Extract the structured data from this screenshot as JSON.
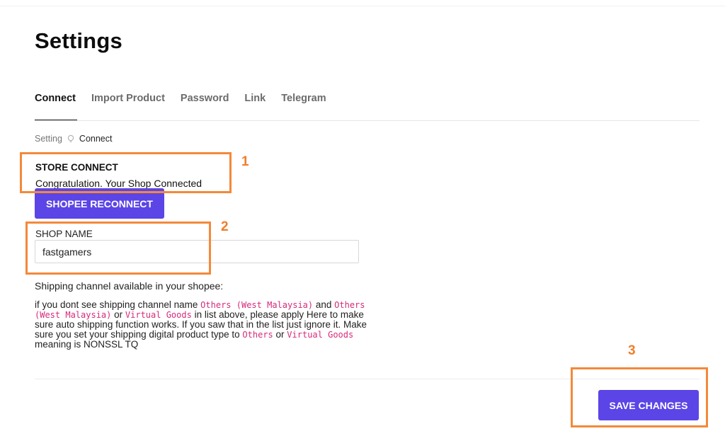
{
  "page": {
    "title": "Settings"
  },
  "tabs": [
    {
      "label": "Connect",
      "active": true
    },
    {
      "label": "Import Product"
    },
    {
      "label": "Password"
    },
    {
      "label": "Link"
    },
    {
      "label": "Telegram"
    }
  ],
  "breadcrumb": {
    "root": "Setting",
    "current": "Connect",
    "separator_icon": "bulb-icon"
  },
  "store": {
    "title": "STORE CONNECT",
    "status": "Congratulation. Your Shop Connected",
    "reconnect_label": "SHOPEE RECONNECT"
  },
  "shop": {
    "label": "SHOP NAME",
    "value": "fastgamers"
  },
  "shipping": {
    "label": "Shipping channel available in your shopee:",
    "note": {
      "t1": "if you dont see shipping channel name ",
      "c1": "Others (West Malaysia)",
      "t2": " and ",
      "c2": "Others (West Malaysia)",
      "t3": " or ",
      "c3": "Virtual Goods",
      "t4": " in list above, please apply Here to make sure auto shipping function works. If you saw that in the list just ignore it. Make sure you set your shipping digital product type to ",
      "c4": "Others",
      "t5": " or ",
      "c5": "Virtual Goods",
      "t6": " meaning is NONSSL TQ"
    }
  },
  "actions": {
    "save_label": "SAVE CHANGES"
  },
  "annotations": {
    "n1": "1",
    "n2": "2",
    "n3": "3"
  },
  "colors": {
    "primary": "#5b45e6",
    "annotation": "#f4893a",
    "code": "#d6297a"
  }
}
